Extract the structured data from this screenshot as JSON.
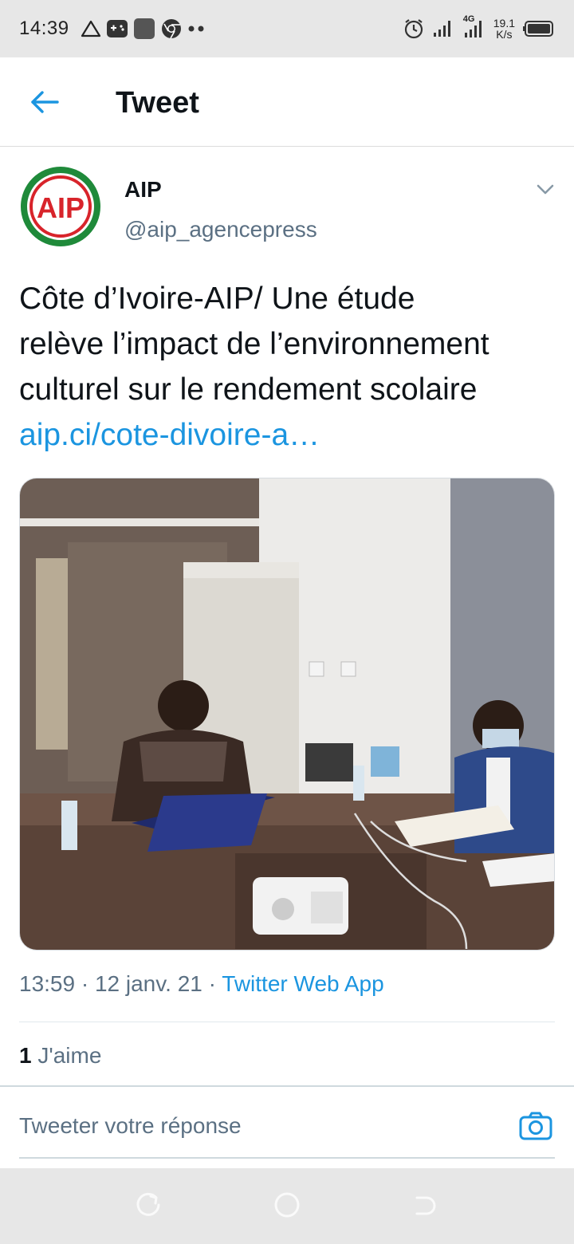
{
  "status_bar": {
    "time": "14:39",
    "left_icons": [
      "warning-icon",
      "gamepad-icon",
      "app-square-icon",
      "chrome-icon",
      "more-dots-icon"
    ],
    "network": "4G",
    "speed_value": "19.1",
    "speed_unit": "K/s"
  },
  "header": {
    "title": "Tweet",
    "back_icon": "arrow-left-icon"
  },
  "tweet": {
    "avatar_logo_text": "AIP",
    "author_name": "AIP",
    "author_handle": "@aip_agencepress",
    "text_lines": [
      "Côte d’Ivoire-AIP/ Une étude",
      "relève l’impact de l’environnement",
      "culturel sur le rendement scolaire"
    ],
    "link": "aip.ci/cote-divoire-a…",
    "media_alt": "photo",
    "time": "13:59",
    "date": "12 janv. 21",
    "source": "Twitter Web App",
    "meta_separator": " · ",
    "likes_count": "1",
    "likes_label": "J'aime"
  },
  "reply": {
    "placeholder": "Tweeter votre réponse"
  },
  "colors": {
    "link_blue": "#1b95e0",
    "secondary_text": "#5b7083",
    "logo_red": "#d8242b",
    "logo_green": "#1f8a3a"
  }
}
